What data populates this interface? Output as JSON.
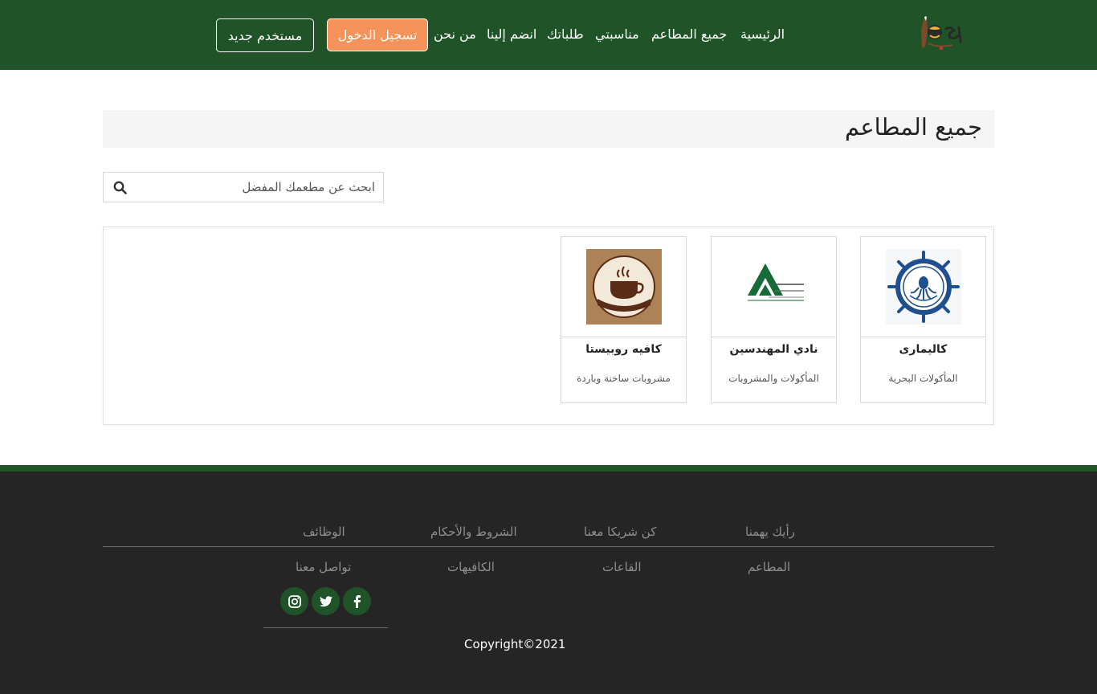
{
  "header": {
    "nav": [
      "الرئيسية",
      "جميع المطاعم",
      "مناسبتي",
      "طلباتك",
      "انضم إلينا",
      "من نحن"
    ],
    "login_label": "تسجيل الدخول",
    "register_label": "مستخدم جديد",
    "logo_icon": "brand-logo-icon",
    "colors": {
      "header_bg": "#205428",
      "login_bg": "#f6935b"
    }
  },
  "main": {
    "title": "جميع المطاعم",
    "search": {
      "placeholder": "ابحث عن مطعمك المفضل",
      "value": "",
      "icon": "search-icon"
    },
    "restaurants": [
      {
        "name": "كاليمارى",
        "category": "المأكولات البحرية",
        "logo_icon": "ship-wheel-logo-icon"
      },
      {
        "name": "نادي المهندسين",
        "category": "المأكولات والمشروبات",
        "logo_icon": "engineers-club-logo-icon"
      },
      {
        "name": "كافيه روبيستا",
        "category": "مشروبات ساخنة وباردة",
        "logo_icon": "coffee-cup-logo-icon"
      }
    ]
  },
  "footer": {
    "row1": [
      "رأيك يهمنا",
      "كن شريكا معنا",
      "الشروط والأحكام",
      "الوظائف"
    ],
    "row2": [
      "المطاعم",
      "القاعات",
      "الكافيهات",
      "تواصل معنا"
    ],
    "social": [
      "facebook-icon",
      "twitter-icon",
      "instagram-icon"
    ],
    "copyright": "Copyright©2021",
    "colors": {
      "footer_bg": "#252525",
      "accent": "#205428"
    }
  }
}
